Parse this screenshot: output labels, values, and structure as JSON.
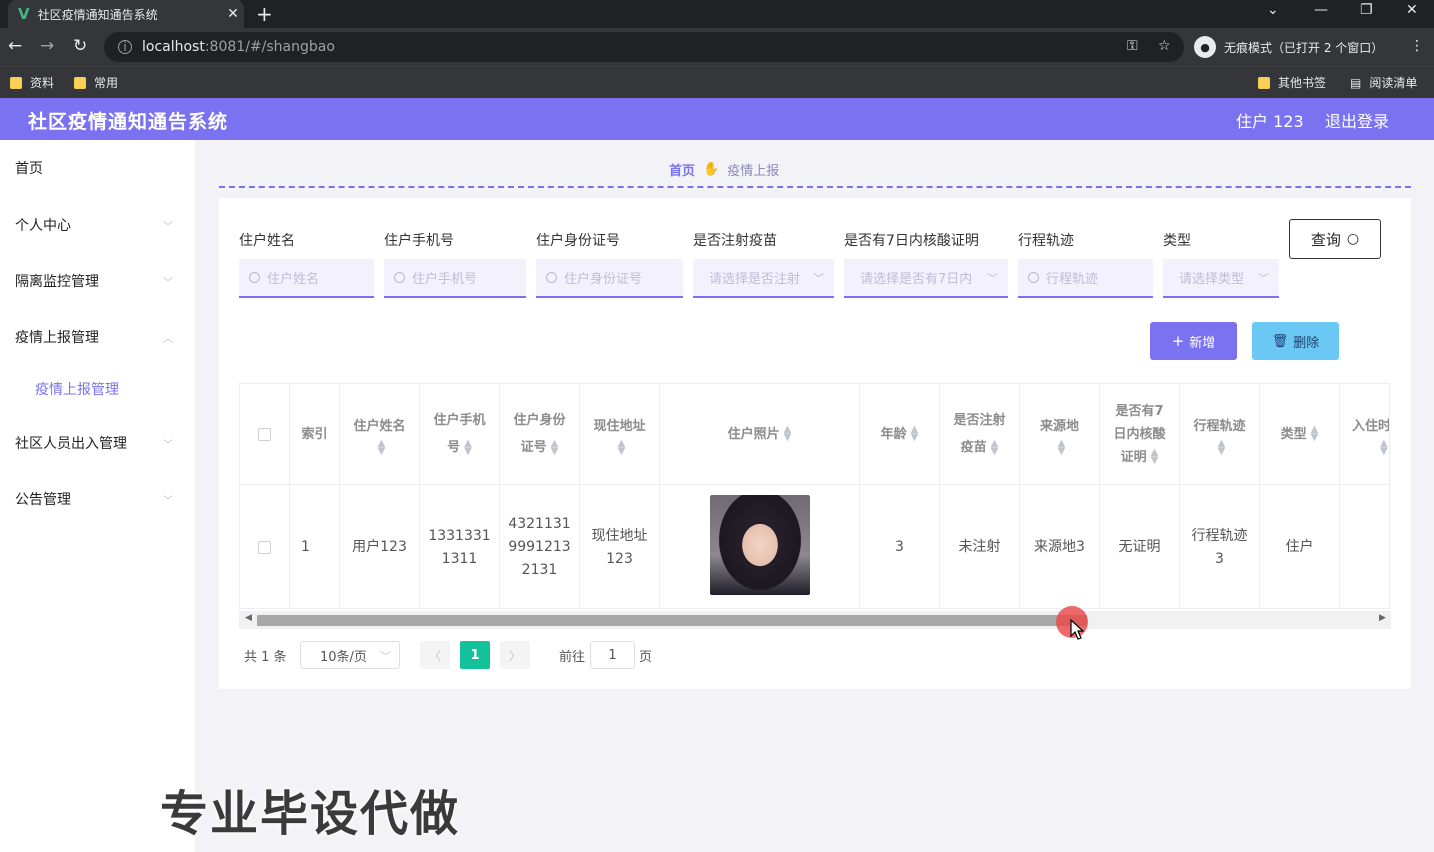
{
  "browser": {
    "tab_title": "社区疫情通知通告系统",
    "tab_close": "✕",
    "new_tab": "+",
    "url_host": "localhost",
    "url_path": ":8081/#/shangbao",
    "incognito_label": "无痕模式（已打开 2 个窗口）",
    "bookmarks": [
      "资料",
      "常用"
    ],
    "bookmarks_right": [
      "其他书签",
      "阅读清单"
    ]
  },
  "header": {
    "title": "社区疫情通知通告系统",
    "user": "住户 123",
    "logout": "退出登录"
  },
  "sidebar": {
    "items": [
      {
        "label": "首页"
      },
      {
        "label": "个人中心"
      },
      {
        "label": "隔离监控管理"
      },
      {
        "label": "疫情上报管理"
      },
      {
        "label": "社区人员出入管理"
      },
      {
        "label": "公告管理"
      }
    ],
    "subitem": "疫情上报管理"
  },
  "breadcrumb": {
    "home": "首页",
    "current": "疫情上报"
  },
  "filters": [
    {
      "label": "住户姓名",
      "placeholder": "住户姓名",
      "type": "input"
    },
    {
      "label": "住户手机号",
      "placeholder": "住户手机号",
      "type": "input"
    },
    {
      "label": "住户身份证号",
      "placeholder": "住户身份证号",
      "type": "input"
    },
    {
      "label": "是否注射疫苗",
      "placeholder": "请选择是否注射",
      "type": "select"
    },
    {
      "label": "是否有7日内核酸证明",
      "placeholder": "请选择是否有7日内",
      "type": "select"
    },
    {
      "label": "行程轨迹",
      "placeholder": "行程轨迹",
      "type": "input"
    },
    {
      "label": "类型",
      "placeholder": "请选择类型",
      "type": "select"
    }
  ],
  "buttons": {
    "query": "查询",
    "add": "新增",
    "delete": "删除"
  },
  "table": {
    "headers": [
      "索引",
      "住户姓名",
      "住户手机号",
      "住户身份证号",
      "现住地址",
      "住户照片",
      "年龄",
      "是否注射疫苗",
      "来源地",
      "是否有7日内核酸证明",
      "行程轨迹",
      "类型",
      "入住时"
    ],
    "header_lines": [
      [
        "索引"
      ],
      [
        "住户姓名"
      ],
      [
        "住户手机",
        "号"
      ],
      [
        "住户身份",
        "证号"
      ],
      [
        "现住地址"
      ],
      [
        "住户照片"
      ],
      [
        "年龄"
      ],
      [
        "是否注射",
        "疫苗"
      ],
      [
        "来源地"
      ],
      [
        "是否有7",
        "日内核酸",
        "证明"
      ],
      [
        "行程轨迹"
      ],
      [
        "类型"
      ],
      [
        "入住时"
      ]
    ],
    "row": {
      "index": "1",
      "name": "用户123",
      "phone_lines": [
        "1331331",
        "1311"
      ],
      "id_lines": [
        "4321131",
        "9991213",
        "2131"
      ],
      "address_lines": [
        "现住地址",
        "123"
      ],
      "age": "3",
      "vaccine": "未注射",
      "origin": "来源地3",
      "nucleic": "无证明",
      "track_lines": [
        "行程轨迹",
        "3"
      ],
      "type": "住户"
    }
  },
  "pagination": {
    "total": "共 1 条",
    "page_size": "10条/页",
    "current": "1",
    "goto_label": "前往",
    "goto_value": "1",
    "page_label": "页"
  },
  "watermark": "专业毕设代做"
}
